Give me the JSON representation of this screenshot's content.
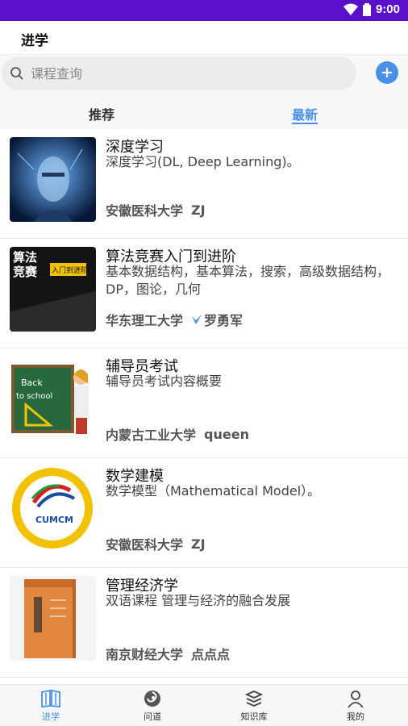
{
  "status_bar": {
    "time": "9:00"
  },
  "app_bar": {
    "title": "进学"
  },
  "search": {
    "placeholder": "课程查询"
  },
  "tabs": [
    {
      "label": "推荐"
    },
    {
      "label": "最新"
    }
  ],
  "courses": [
    {
      "title": "深度学习",
      "description": "深度学习(DL, Deep Learning)。",
      "university": "安徽医科大学",
      "teacher": "ZJ"
    },
    {
      "title": "算法竞赛入门到进阶",
      "description": "基本数据结构，基本算法，搜索，高级数据结构，DP，图论，几何",
      "university": "华东理工大学",
      "teacher": "罗勇军"
    },
    {
      "title": "辅导员考试",
      "description": "辅导员考试内容概要",
      "university": "内蒙古工业大学",
      "teacher": "queen"
    },
    {
      "title": "数学建模",
      "description": "数学模型（Mathematical Model）。",
      "university": "安徽医科大学",
      "teacher": "ZJ"
    },
    {
      "title": "管理经济学",
      "description": "双语课程 管理与经济的融合发展",
      "university": "南京财经大学",
      "teacher": "点点点"
    }
  ],
  "thumb_text": {
    "algo_cover": "算法竞赛",
    "algo_subtitle": "入门到进阶",
    "school_board": "Back to school",
    "cumcm": "CUMCM"
  },
  "bottom_nav": [
    {
      "label": "进学",
      "icon": "book-icon",
      "active": true
    },
    {
      "label": "问道",
      "icon": "swirl-icon",
      "active": false
    },
    {
      "label": "知识库",
      "icon": "stack-icon",
      "active": false
    },
    {
      "label": "我的",
      "icon": "person-icon",
      "active": false
    }
  ],
  "colors": {
    "status_bar": "#5a0fc8",
    "accent": "#4a90e8",
    "teacher_badge": "#4a90e8"
  }
}
